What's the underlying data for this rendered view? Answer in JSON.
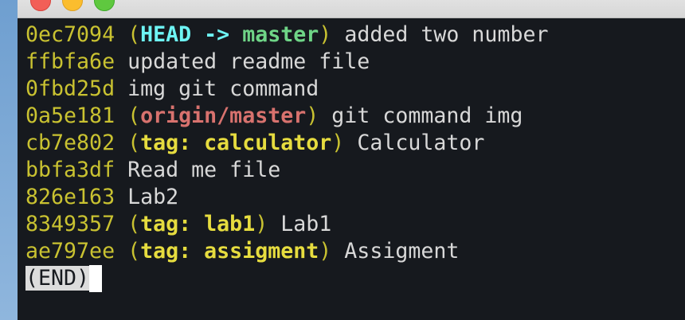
{
  "commits": [
    {
      "hash": "0ec7094",
      "head": "HEAD",
      "arrow": " -> ",
      "branch": "master",
      "message": "added two number"
    },
    {
      "hash": "ffbfa6e",
      "message": "updated readme file"
    },
    {
      "hash": "0fbd25d",
      "message": "img git command"
    },
    {
      "hash": "0a5e181",
      "remote": "origin/master",
      "message": "git command img"
    },
    {
      "hash": "cb7e802",
      "tag": "tag: calculator",
      "message": "Calculator"
    },
    {
      "hash": "bbfa3df",
      "message": "Read me file"
    },
    {
      "hash": "826e163",
      "message": "Lab2"
    },
    {
      "hash": "8349357",
      "tag": "tag: lab1",
      "message": "Lab1"
    },
    {
      "hash": "ae797ee",
      "tag": "tag: assigment",
      "message": "Assigment"
    }
  ],
  "pager_end": "(END)",
  "colors": {
    "hash": "#c9c231",
    "head": "#6ef4f4",
    "branch": "#6fd587",
    "remote": "#d8726e",
    "tag": "#e6dc3f",
    "background": "#16191e"
  }
}
